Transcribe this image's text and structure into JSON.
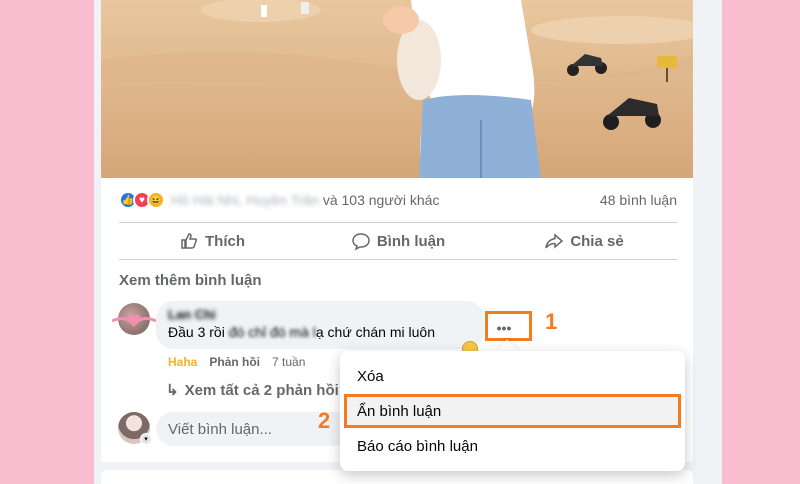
{
  "post": {
    "reactions_icons": [
      "like-icon",
      "love-icon",
      "haha-icon"
    ],
    "reactor_name_blurred": "Hồ Hải Nhi, Huyền Trân",
    "reactions_text": "và 103 người khác",
    "comments_count": "48 bình luận"
  },
  "actions": {
    "like": "Thích",
    "comment": "Bình luận",
    "share": "Chia sẻ"
  },
  "comments": {
    "see_more": "Xem thêm bình luận",
    "first": {
      "author_blurred": "Lan Chi",
      "text_start": "Đầu 3 rồi",
      "text_blurred": " đó chỉ đó mà l",
      "text_end": "ạ chứ chán mi luôn",
      "reaction_label": "Haha",
      "reply_label": "Phản hồi",
      "time": "7 tuần"
    },
    "view_replies": "Xem tất cả 2 phản hồi",
    "write_placeholder": "Viết bình luận..."
  },
  "menu": {
    "items": [
      "Xóa",
      "Ẩn bình luận",
      "Báo cáo bình luận"
    ]
  },
  "annotations": {
    "step1": "1",
    "step2": "2",
    "highlight_color": "#f47b20"
  },
  "colors": {
    "background": "#f9bdd0",
    "like_blue": "#1877f2",
    "love_red": "#f33e58",
    "haha_yellow": "#f7b125"
  }
}
